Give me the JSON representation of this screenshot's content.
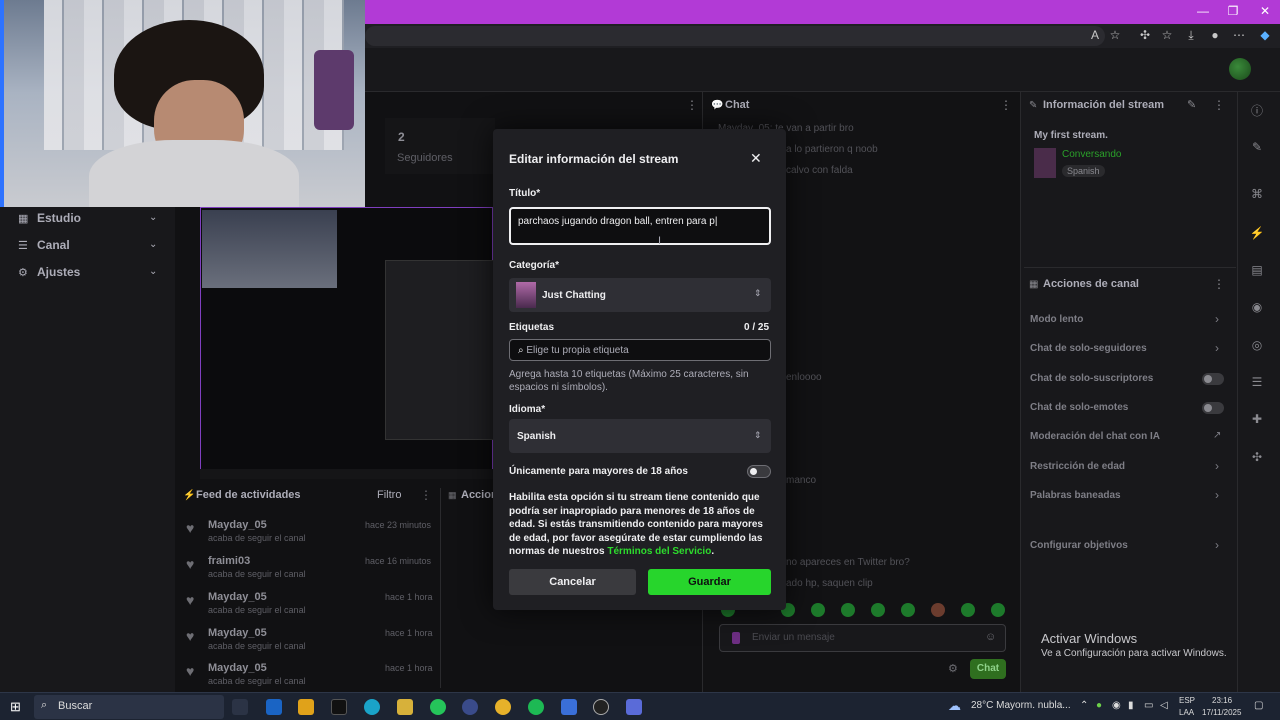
{
  "browser": {
    "icons": [
      "read-aloud-icon",
      "favorite-icon",
      "extensions-icon",
      "favorites-icon",
      "downloads-icon",
      "profile-icon",
      "more-icon",
      "copilot-icon"
    ]
  },
  "left_nav": {
    "items": [
      {
        "label": "Estudio",
        "icon": "studio-icon"
      },
      {
        "label": "Canal",
        "icon": "channel-icon"
      },
      {
        "label": "Ajustes",
        "icon": "settings-icon"
      }
    ]
  },
  "stats": {
    "followers_count": "2",
    "followers_label": "Seguidores"
  },
  "feed": {
    "title": "Feed de actividades",
    "filter_label": "Filtro",
    "actions_label": "Accion",
    "items": [
      {
        "name": "Mayday_05",
        "sub": "acaba de seguir el canal",
        "time": "hace 23 minutos"
      },
      {
        "name": "fraimi03",
        "sub": "acaba de seguir el canal",
        "time": "hace 16 minutos"
      },
      {
        "name": "Mayday_05",
        "sub": "acaba de seguir el canal",
        "time": "hace 1 hora"
      },
      {
        "name": "Mayday_05",
        "sub": "acaba de seguir el canal",
        "time": "hace 1 hora"
      },
      {
        "name": "Mayday_05",
        "sub": "acaba de seguir el canal",
        "time": "hace 1 hora"
      }
    ]
  },
  "chat": {
    "title": "Chat",
    "lines": [
      "Mayday_05: te van a partir bro",
      "a lo partieron q noob",
      "calvo con falda",
      "enloooo",
      "manco",
      "no apareces en Twitter bro?",
      "ado hp, saquen clip"
    ],
    "input_placeholder": "Enviar un mensaje",
    "send_label": "Chat"
  },
  "stream_info": {
    "title": "Información del stream",
    "stream_title": "My first stream.",
    "category": "Conversando",
    "language_tag": "Spanish"
  },
  "channel_actions": {
    "title": "Acciones de canal",
    "items": [
      {
        "label": "Modo lento",
        "control": "chevron"
      },
      {
        "label": "Chat de solo-seguidores",
        "control": "chevron"
      },
      {
        "label": "Chat de solo-suscriptores",
        "control": "toggle"
      },
      {
        "label": "Chat de solo-emotes",
        "control": "toggle"
      },
      {
        "label": "Moderación del chat con IA",
        "control": "external"
      },
      {
        "label": "Restricción de edad",
        "control": "chevron"
      },
      {
        "label": "Palabras baneadas",
        "control": "chevron"
      },
      {
        "label": "Configurar objetivos",
        "control": "chevron"
      }
    ]
  },
  "modal": {
    "title": "Editar información del stream",
    "title_label": "Título*",
    "title_value": "parchaos jugando dragon ball, entren para p",
    "category_label": "Categoría*",
    "category_value": "Just Chatting",
    "tags_label": "Etiquetas",
    "tags_count": "0 / 25",
    "tags_placeholder": "Elige tu propia etiqueta",
    "tags_help_1": "Agrega hasta 10 etiquetas (Máximo 25 caracteres, sin",
    "tags_help_2": "espacios ni símbolos).",
    "language_label": "Idioma*",
    "language_value": "Spanish",
    "adult_label": "Únicamente para mayores de 18 años",
    "adult_text": "Habilita esta opción si tu stream tiene contenido que podría ser inapropiado para menores de 18 años de edad. Si estás transmitiendo contenido para mayores de edad, por favor asegúrate de estar cumpliendo las normas de nuestros",
    "adult_link": "Términos del Servicio",
    "adult_end": ".",
    "cancel_label": "Cancelar",
    "save_label": "Guardar"
  },
  "watermark": {
    "line1": "Activar Windows",
    "line2": "Ve a Configuración para activar Windows."
  },
  "taskbar": {
    "search_placeholder": "Buscar",
    "weather": "28°C  Mayorm. nubla...",
    "lang_1": "ESP",
    "lang_2": "LAA",
    "time": "23:16",
    "date": "17/11/2025"
  }
}
